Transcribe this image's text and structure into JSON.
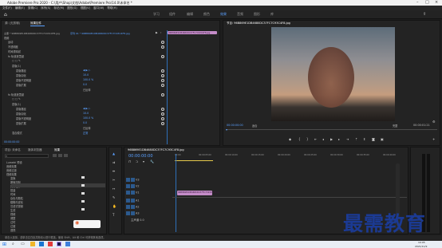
{
  "window": {
    "title": "Adobe Premiere Pro 2020 - C:\\用户\\Shop\\文档\\Adobe\\Premiere Pro\\14.0\\未命名 *"
  },
  "menu": [
    "文件(F)",
    "编辑(E)",
    "剪辑(C)",
    "序列(S)",
    "标记(M)",
    "图形(G)",
    "视图(V)",
    "窗口(W)",
    "帮助(H)"
  ],
  "workspaces": {
    "tabs": [
      "学习",
      "组件",
      "编辑",
      "颜色",
      "效果",
      "音频",
      "图形",
      "库"
    ],
    "active_index": 4
  },
  "effect_controls": {
    "tabs": [
      "源: (无剪辑)",
      "效果控件",
      "Lumetri 范围",
      "音频剪辑混合器: 序列 01"
    ],
    "active_tab": 1,
    "source": "主要 * 96B869E1DB4680DC37FC7C93C4F8.jpg",
    "sequence": "序列 01 * 96B869E1DB4680DC37FC7C93C4F8.jpg",
    "mini_clip": "96B869E1DB4680DC37FC7C93C4F8.jpg",
    "rows": [
      {
        "label": "视频",
        "value": ""
      },
      {
        "label": "运动",
        "value": ""
      },
      {
        "label": "不透明度",
        "value": ""
      },
      {
        "label": "时间重映射",
        "value": ""
      },
      {
        "label": "fx  轨道遮罩键",
        "value": ""
      },
      {
        "label": "□ □ ✎",
        "value": ""
      },
      {
        "label": "蒙版(1)",
        "value": ""
      },
      {
        "label": "蒙版路径",
        "value": "◀ ▶ ▷"
      },
      {
        "label": "蒙版羽化",
        "value": "10.0"
      },
      {
        "label": "蒙版不透明度",
        "value": "100.0 %"
      },
      {
        "label": "蒙版扩展",
        "value": "0.0"
      },
      {
        "label": "",
        "value": "已反转"
      },
      {
        "label": "fx  轨道遮罩键",
        "value": ""
      },
      {
        "label": "□ □ ✎",
        "value": ""
      },
      {
        "label": "蒙版(1)",
        "value": ""
      },
      {
        "label": "蒙版路径",
        "value": "◀ ▶ ▷"
      },
      {
        "label": "蒙版羽化",
        "value": "10.0"
      },
      {
        "label": "蒙版不透明度",
        "value": "100.0 %"
      },
      {
        "label": "蒙版扩展",
        "value": "0.0"
      },
      {
        "label": "",
        "value": "已反转"
      },
      {
        "label": "混合模式",
        "value": "正常"
      }
    ]
  },
  "program_monitor": {
    "title": "节目: 96B869E1DB4680DC37FC7C93C4F8.jpg",
    "timecode_left": "00:00:00:00",
    "fit": "适合",
    "quality": "完整",
    "timecode_right": "00:00:01:21"
  },
  "project_panel": {
    "tabs": [
      "项目: 未命名",
      "媒体浏览器",
      "效果"
    ],
    "active_tab": 2,
    "tree": [
      "Lumetri 预设",
      "音频效果",
      "音频过渡",
      "视频效果",
      "变换",
      "图像控制",
      "实用程序",
      "扭曲",
      "时间",
      "杂色与颗粒",
      "模糊与锐化",
      "沉浸式视频",
      "生成",
      "视频",
      "调整",
      "过时",
      "过渡",
      "透视",
      "通道",
      "键控",
      "颜色校正",
      "风格化",
      "视频过渡"
    ]
  },
  "timeline": {
    "tab": "96B869E1DB4680DC37FC7C93C4F8.jpg",
    "timecode": "00:00:00:00",
    "ruler": [
      "00:00",
      "00:00:05:00",
      "00:00:10:00",
      "00:00:15:00",
      "00:00:20:00",
      "00:00:25:00",
      "00:00:30:00",
      "00:00:35:00",
      "00:00:40:00"
    ],
    "tracks": [
      "V3",
      "V2",
      "V1",
      "A1",
      "A2",
      "A3",
      "主声道"
    ],
    "master_value": "0.0",
    "clip": "96B869E1DB4680DC37FC7C93C4F8.jpg"
  },
  "status": "单击以选择，或单击空白处并拖动以进行框选。使用 Shift、Alt 和 Ctrl 可获得其他选项。",
  "taskbar": {
    "time": "10:05",
    "date": "2021/11/9"
  },
  "watermark": "最需教育"
}
